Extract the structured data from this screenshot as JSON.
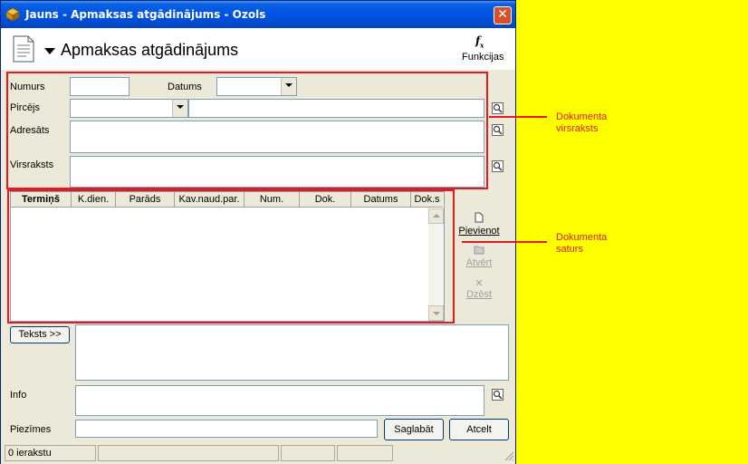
{
  "window": {
    "title": "Jauns - Apmaksas atgādinājums - Ozols",
    "close_glyph": "✕"
  },
  "header": {
    "title": "Apmaksas atgādinājums",
    "functions_label": "Funkcijas",
    "functions_icon": "fx-icon",
    "doc_icon": "document-icon"
  },
  "form": {
    "numurs_label": "Numurs",
    "numurs_value": "",
    "datums_label": "Datums",
    "datums_value": "",
    "pircejs_label": "Pircējs",
    "pircejs_code": "",
    "pircejs_name": "",
    "adresats_label": "Adresāts",
    "adresats_value": "",
    "virsraksts_label": "Virsraksts",
    "virsraksts_value": ""
  },
  "grid": {
    "columns": [
      "Termiņš",
      "K.dien.",
      "Parāds",
      "Kav.naud.par.",
      "Num.",
      "Dok.",
      "Datums",
      "Dok.s"
    ],
    "rows": []
  },
  "side_actions": {
    "add": "Pievienot",
    "open": "Atvērt",
    "delete": "Dzēst"
  },
  "bottom": {
    "text_button": "Teksts >>",
    "text_value": "",
    "info_label": "Info",
    "info_value": "",
    "notes_label": "Piezīmes",
    "notes_value": "",
    "save_button": "Saglabāt",
    "cancel_button": "Atcelt"
  },
  "status": {
    "records": "0 ierakstu"
  },
  "annotations": {
    "header_note_line1": "Dokumenta",
    "header_note_line2": "virsraksts",
    "content_note_line1": "Dokumenta",
    "content_note_line2": "saturs"
  },
  "colors": {
    "highlight": "#e5191e",
    "background": "#ffff00",
    "titlebar": "#0054e3"
  }
}
